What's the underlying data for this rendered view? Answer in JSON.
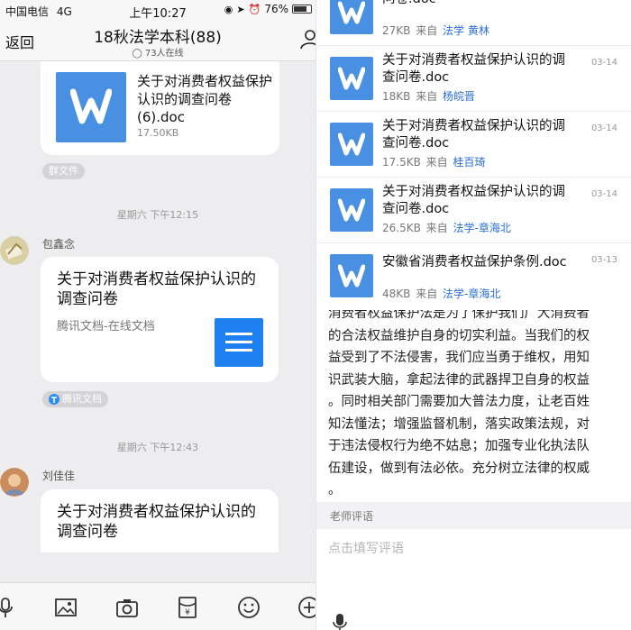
{
  "status_bar": {
    "carrier": "中国电信",
    "network": "4G",
    "time": "上午10:27",
    "battery": "76%"
  },
  "nav": {
    "back_label": "返回",
    "title": "18秋法学本科(88)",
    "online": "73人在线"
  },
  "chat": {
    "file_message": {
      "filename": "关于对消费者权益保护认识的调查问卷(6).doc",
      "size": "17.50KB",
      "tag": "群文件"
    },
    "messages": [
      {
        "timestamp": "星期六 下午12:15",
        "sender": "包鑫念",
        "title": "关于对消费者权益保护认识的调查问卷",
        "source": "腾讯文档-在线文档",
        "tag": "腾讯文档"
      },
      {
        "timestamp": "星期六 下午12:43",
        "sender": "刘佳佳",
        "title": "关于对消费者权益保护认识的调查问卷"
      }
    ]
  },
  "file_list": [
    {
      "name_line1": "",
      "name_line2": "问卷.doc",
      "size": "27KB",
      "from": "来自",
      "who": "法学 黄林",
      "date": ""
    },
    {
      "name_line1": "关于对消费者权益保护认识的调",
      "name_line2": "查问卷.doc",
      "size": "18KB",
      "from": "来自",
      "who": "杨皖晋",
      "date": "03-14"
    },
    {
      "name_line1": "关于对消费者权益保护认识的调",
      "name_line2": "查问卷.doc",
      "size": "17.5KB",
      "from": "来自",
      "who": "桂百琦",
      "date": "03-14"
    },
    {
      "name_line1": "关于对消费者权益保护认识的调",
      "name_line2": "查问卷.doc",
      "size": "26.5KB",
      "from": "来自",
      "who": "法学-章海北",
      "date": "03-14"
    },
    {
      "name_line1": "安徽省消费者权益保护条例.doc",
      "name_line2": "",
      "size": "48KB",
      "from": "来自",
      "who": "法学-章海北",
      "date": "03-13"
    }
  ],
  "essay": {
    "lines": [
      "消费者权益保护法是为了保护我们广大消费者",
      "的合法权益维护自身的切实利益。当我们的权",
      "益受到了不法侵害，我们应当勇于维权，用知",
      "识武装大脑，拿起法律的武器捍卫自身的权益",
      "。同时相关部门需要加大普法力度，让老百姓",
      "知法懂法；增强监督机制，落实政策法规，对",
      "于违法侵权行为绝不姑息；加强专业化执法队",
      "伍建设，做到有法必依。充分树立法律的权威",
      "。"
    ]
  },
  "comment": {
    "section_label": "老师评语",
    "placeholder": "点击填写评语"
  },
  "colors": {
    "word_blue": "#4a90e2",
    "doc_blue": "#1e7ff0",
    "link_blue": "#2b6fd6"
  }
}
